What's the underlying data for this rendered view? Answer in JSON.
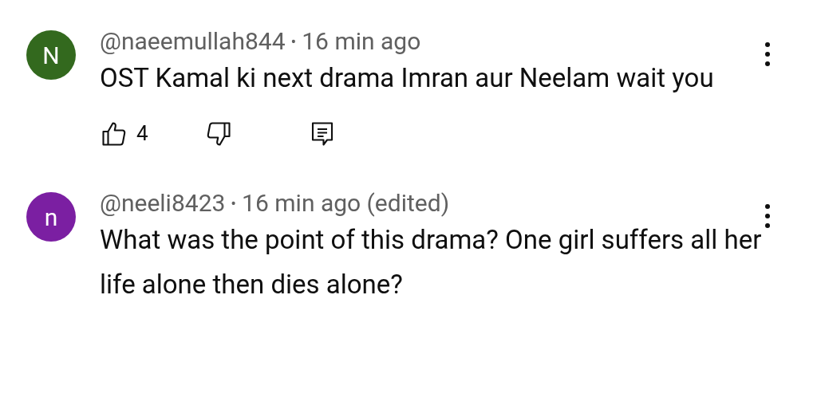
{
  "comments": [
    {
      "avatar": {
        "letter": "N",
        "color": "#33691e"
      },
      "handle": "@naeemullah844",
      "separator": "•",
      "time": "16 min ago",
      "text": "OST Kamal ki next drama Imran aur Neelam wait you",
      "likes": "4",
      "show_actions": true
    },
    {
      "avatar": {
        "letter": "n",
        "color": "#7b1fa2"
      },
      "handle": "@neeli8423",
      "separator": "•",
      "time": "16 min ago (edited)",
      "text": "What was the point of this drama? One girl suffers all her life alone then dies alone?",
      "show_actions": false
    }
  ]
}
